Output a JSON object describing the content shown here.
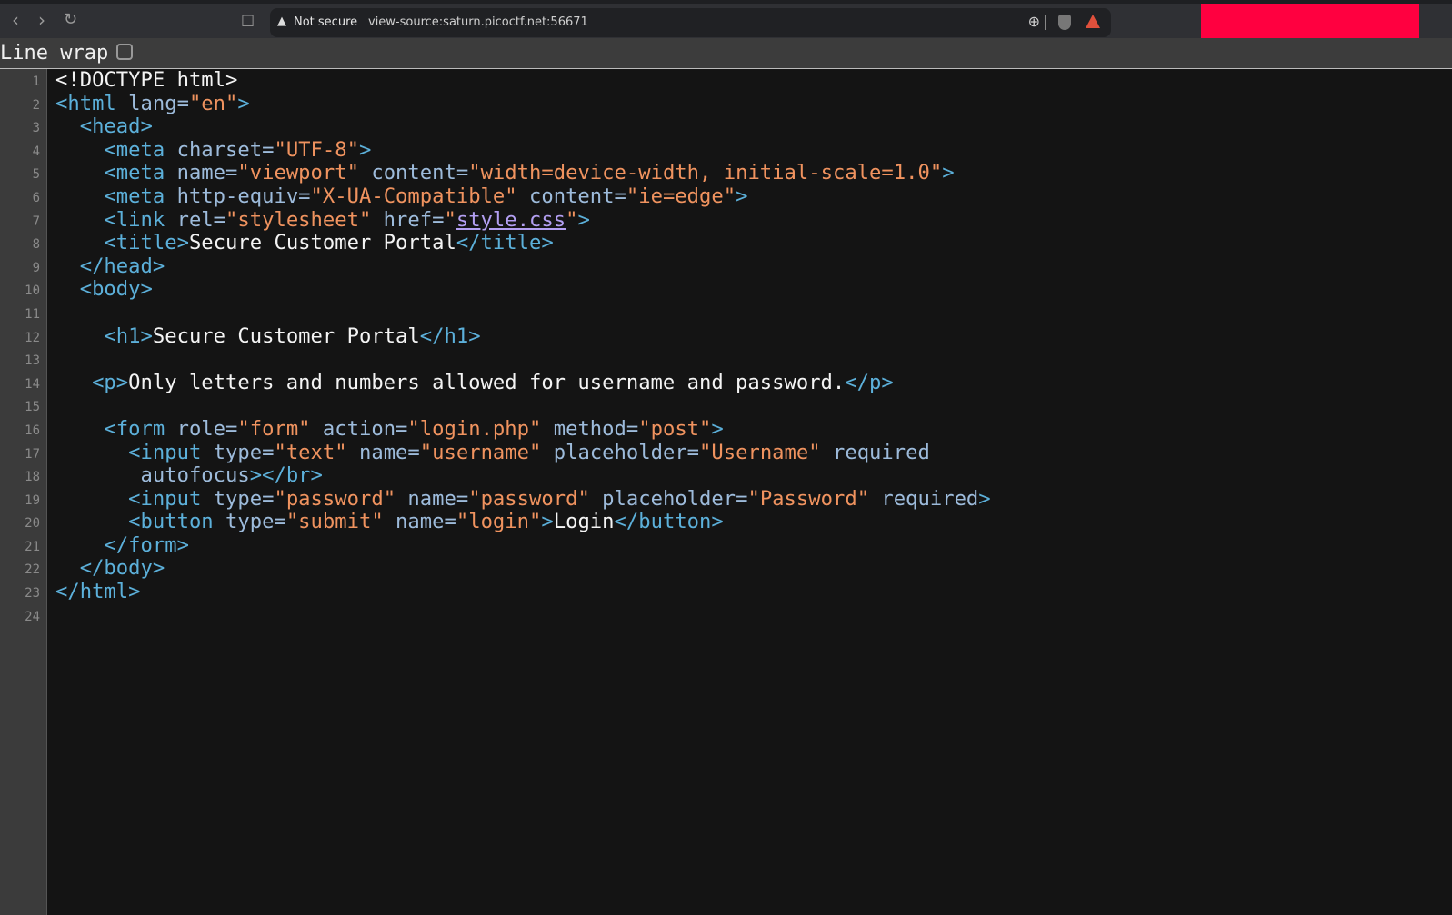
{
  "browser": {
    "security_label": "Not secure",
    "url": "view-source:saturn.picoctf.net:56671"
  },
  "toolbar": {
    "line_wrap_label": "Line wrap",
    "line_wrap_checked": false
  },
  "colors": {
    "tag": "#5cb0da",
    "attr": "#9dbbdb",
    "value": "#f0935f",
    "link": "#b39ff2",
    "redacted": "#ff0040"
  },
  "lines": [
    [
      [
        "text",
        "<!DOCTYPE html>"
      ]
    ],
    [
      [
        "tag",
        "<html "
      ],
      [
        "attr",
        "lang="
      ],
      [
        "val",
        "\"en\""
      ],
      [
        "tag",
        ">"
      ]
    ],
    [
      [
        "text",
        "  "
      ],
      [
        "tag",
        "<head>"
      ]
    ],
    [
      [
        "text",
        "    "
      ],
      [
        "tag",
        "<meta "
      ],
      [
        "attr",
        "charset="
      ],
      [
        "val",
        "\"UTF-8\""
      ],
      [
        "tag",
        ">"
      ]
    ],
    [
      [
        "text",
        "    "
      ],
      [
        "tag",
        "<meta "
      ],
      [
        "attr",
        "name="
      ],
      [
        "val",
        "\"viewport\""
      ],
      [
        "attr",
        " content="
      ],
      [
        "val",
        "\"width=device-width, initial-scale=1.0\""
      ],
      [
        "tag",
        ">"
      ]
    ],
    [
      [
        "text",
        "    "
      ],
      [
        "tag",
        "<meta "
      ],
      [
        "attr",
        "http-equiv="
      ],
      [
        "val",
        "\"X-UA-Compatible\""
      ],
      [
        "attr",
        " content="
      ],
      [
        "val",
        "\"ie=edge\""
      ],
      [
        "tag",
        ">"
      ]
    ],
    [
      [
        "text",
        "    "
      ],
      [
        "tag",
        "<link "
      ],
      [
        "attr",
        "rel="
      ],
      [
        "val",
        "\"stylesheet\""
      ],
      [
        "attr",
        " href="
      ],
      [
        "val",
        "\""
      ],
      [
        "link",
        "style.css"
      ],
      [
        "val",
        "\""
      ],
      [
        "tag",
        ">"
      ]
    ],
    [
      [
        "text",
        "    "
      ],
      [
        "tag",
        "<title>"
      ],
      [
        "text",
        "Secure Customer Portal"
      ],
      [
        "tag",
        "</title>"
      ]
    ],
    [
      [
        "text",
        "  "
      ],
      [
        "tag",
        "</head>"
      ]
    ],
    [
      [
        "text",
        "  "
      ],
      [
        "tag",
        "<body>"
      ]
    ],
    [
      [
        "text",
        ""
      ]
    ],
    [
      [
        "text",
        "    "
      ],
      [
        "tag",
        "<h1>"
      ],
      [
        "text",
        "Secure Customer Portal"
      ],
      [
        "tag",
        "</h1>"
      ]
    ],
    [
      [
        "text",
        ""
      ]
    ],
    [
      [
        "text",
        "   "
      ],
      [
        "tag",
        "<p>"
      ],
      [
        "text",
        "Only letters and numbers allowed for username and password."
      ],
      [
        "tag",
        "</p>"
      ]
    ],
    [
      [
        "text",
        ""
      ]
    ],
    [
      [
        "text",
        "    "
      ],
      [
        "tag",
        "<form "
      ],
      [
        "attr",
        "role="
      ],
      [
        "val",
        "\"form\""
      ],
      [
        "attr",
        " action="
      ],
      [
        "val",
        "\"login.php\""
      ],
      [
        "attr",
        " method="
      ],
      [
        "val",
        "\"post\""
      ],
      [
        "tag",
        ">"
      ]
    ],
    [
      [
        "text",
        "      "
      ],
      [
        "tag",
        "<input "
      ],
      [
        "attr",
        "type="
      ],
      [
        "val",
        "\"text\""
      ],
      [
        "attr",
        " name="
      ],
      [
        "val",
        "\"username\""
      ],
      [
        "attr",
        " placeholder="
      ],
      [
        "val",
        "\"Username\""
      ],
      [
        "attr",
        " required"
      ]
    ],
    [
      [
        "text",
        "       "
      ],
      [
        "attr",
        "autofocus"
      ],
      [
        "tag",
        "></br>"
      ]
    ],
    [
      [
        "text",
        "      "
      ],
      [
        "tag",
        "<input "
      ],
      [
        "attr",
        "type="
      ],
      [
        "val",
        "\"password\""
      ],
      [
        "attr",
        " name="
      ],
      [
        "val",
        "\"password\""
      ],
      [
        "attr",
        " placeholder="
      ],
      [
        "val",
        "\"Password\""
      ],
      [
        "attr",
        " required"
      ],
      [
        "tag",
        ">"
      ]
    ],
    [
      [
        "text",
        "      "
      ],
      [
        "tag",
        "<button "
      ],
      [
        "attr",
        "type="
      ],
      [
        "val",
        "\"submit\""
      ],
      [
        "attr",
        " name="
      ],
      [
        "val",
        "\"login\""
      ],
      [
        "tag",
        ">"
      ],
      [
        "text",
        "Login"
      ],
      [
        "tag",
        "</button>"
      ]
    ],
    [
      [
        "text",
        "    "
      ],
      [
        "tag",
        "</form>"
      ]
    ],
    [
      [
        "text",
        "  "
      ],
      [
        "tag",
        "</body>"
      ]
    ],
    [
      [
        "tag",
        "</html>"
      ]
    ],
    [
      [
        "text",
        ""
      ]
    ]
  ]
}
